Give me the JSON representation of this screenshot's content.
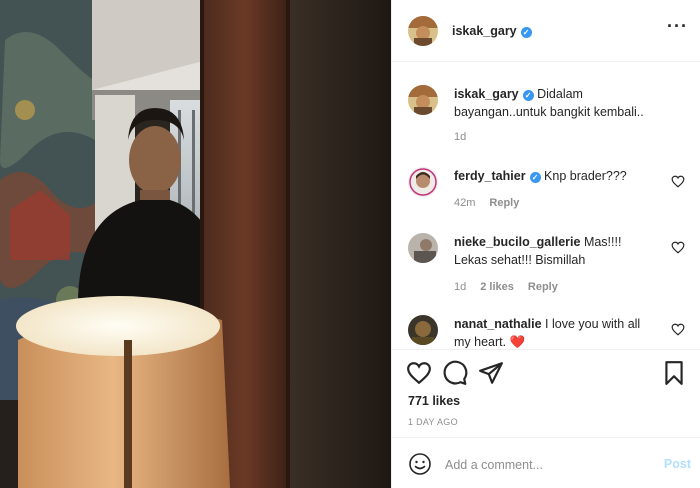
{
  "header": {
    "username": "iskak_gary",
    "verified_badge": "✓",
    "more_icon": "more-options-icon",
    "more_glyph": "···"
  },
  "caption": {
    "username": "iskak_gary",
    "text": "Didalam bayangan..untuk bangkit kembali..",
    "time": "1d"
  },
  "comments": [
    {
      "username": "ferdy_tahier",
      "verified": true,
      "text": "Knp brader???",
      "time": "42m",
      "likes": "",
      "reply": "Reply"
    },
    {
      "username": "nieke_bucilo_gallerie",
      "verified": false,
      "text": "Mas!!!! Lekas sehat!!! Bismillah",
      "time": "1d",
      "likes": "2 likes",
      "reply": "Reply"
    },
    {
      "username": "nanat_nathalie",
      "verified": false,
      "text": "I love you with all my heart.",
      "emoji": "❤️",
      "time": "",
      "likes": "",
      "reply": ""
    }
  ],
  "actions": {
    "likes_count": "771 likes",
    "date": "1 DAY AGO"
  },
  "add_comment": {
    "placeholder": "Add a comment...",
    "post_label": "Post"
  },
  "colors": {
    "verified": "#3897f0",
    "muted": "#8e8e8e",
    "post_disabled": "#b2dffc",
    "heart_red": "#ed4956"
  }
}
